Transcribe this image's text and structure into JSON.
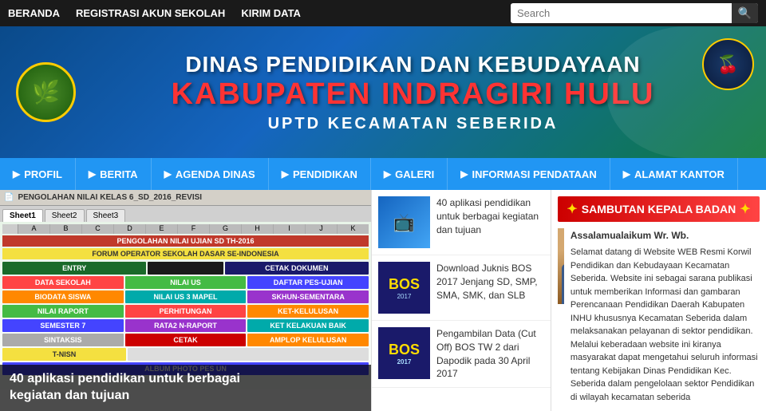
{
  "topbar": {
    "nav": [
      {
        "label": "BERANDA",
        "id": "beranda"
      },
      {
        "label": "REGISTRASI AKUN SEKOLAH",
        "id": "registrasi"
      },
      {
        "label": "KIRIM DATA",
        "id": "kirim-data"
      }
    ],
    "search_placeholder": "Search"
  },
  "banner": {
    "line1": "DINAS PENDIDIKAN DAN KEBUDAYAAN",
    "line2": "KABUPATEN INDRAGIRI HULU",
    "line3": "UPTD KECAMATAN SEBERIDA"
  },
  "mainnav": {
    "items": [
      {
        "label": "PROFIL",
        "id": "profil"
      },
      {
        "label": "BERITA",
        "id": "berita"
      },
      {
        "label": "AGENDA DINAS",
        "id": "agenda"
      },
      {
        "label": "PENDIDIKAN",
        "id": "pendidikan"
      },
      {
        "label": "GALERI",
        "id": "galeri"
      },
      {
        "label": "INFORMASI PENDATAAN",
        "id": "informasi"
      },
      {
        "label": "ALAMAT KANTOR",
        "id": "alamat"
      }
    ]
  },
  "spreadsheet": {
    "window_title": "PENGOLAHAN NILAI KELAS 6_SD_2016_REVISI",
    "inner_title": "PENGOLAHAN NILAI UJIAN SD TH-2016",
    "header_label": "ENTRY",
    "header_label2": "CETAK DOKUMEN",
    "rows": [
      {
        "col1": "DATA SEKOLAH",
        "col2": "NILAI US",
        "col3": "DAFTAR PES-UJIAN"
      },
      {
        "col1": "BIODATA SISWA",
        "col2": "NILAI US 3 MAPEL",
        "col3": "SKHUN-SEMENTARA"
      },
      {
        "col1": "NILAI RAPORT",
        "col2": "PERHITUNGAN",
        "col3": "KET-KELULUSAN"
      },
      {
        "col1": "SEMESTER 7",
        "col2": "RATA2 N-RAPORT",
        "col3": "KET KELAKUAN BAIK"
      },
      {
        "col1": "SINTAKSIS",
        "col2": "CETAK",
        "col3": "AMPLOP KELULUSAN"
      }
    ],
    "footer_rows": [
      {
        "col1": "T-NISN"
      },
      {
        "col1": "ALBUM PHOTO PES UN"
      }
    ]
  },
  "overlay_text": {
    "line1": "40 aplikasi pendidikan untuk berbagai",
    "line2": "kegiatan dan tujuan"
  },
  "articles": [
    {
      "id": "art1",
      "thumb_type": "apps",
      "text": "40 aplikasi pendidikan untuk berbagai kegiatan dan tujuan"
    },
    {
      "id": "art2",
      "thumb_type": "bos",
      "text": "Download Juknis BOS 2017 Jenjang SD, SMP, SMA, SMK, dan SLB"
    },
    {
      "id": "art3",
      "thumb_type": "bos2",
      "text": "Pengambilan Data (Cut Off) BOS TW 2 dari Dapodik pada 30 April 2017"
    }
  ],
  "sambutan": {
    "header": "SAMBUTAN KEPALA BADAN",
    "greeting": "Assalamualaikum Wr. Wb.",
    "text": "Selamat datang di Website WEB Resmi Korwil Pendidikan dan Kebudayaan Kecamatan Seberida. Website ini sebagai sarana publikasi untuk memberikan Informasi dan gambaran Perencanaan Pendidikan Daerah Kabupaten INHU khususnya Kecamatan Seberida dalam melaksanakan pelayanan di sektor pendidikan. Melalui keberadaan website ini kiranya masyarakat dapat mengetahui seluruh informasi tentang Kebijakan Dinas Pendidikan Kec. Seberida dalam pengelolaan sektor Pendidikan di wilayah kecamatan seberida"
  }
}
